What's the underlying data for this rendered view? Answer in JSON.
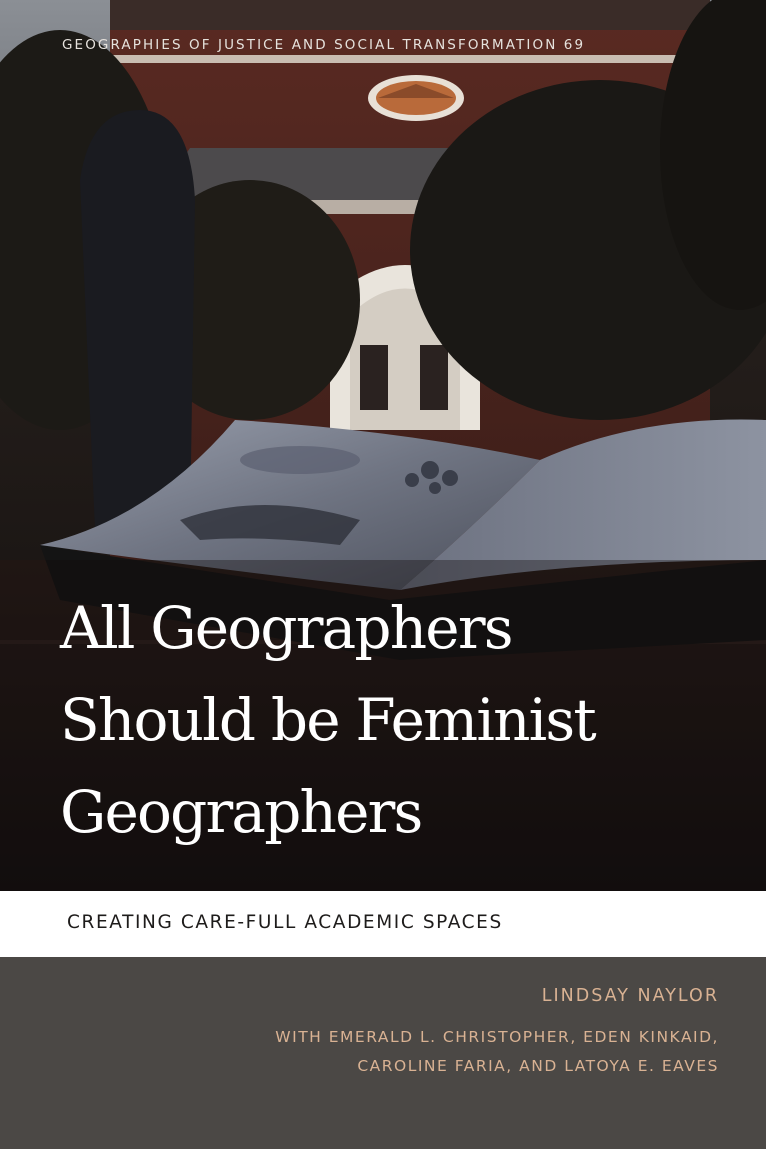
{
  "series": "GEOGRAPHIES OF JUSTICE AND SOCIAL TRANSFORMATION 69",
  "title_lines": [
    "All Geographers",
    "Should be Feminist",
    "Geographers"
  ],
  "subtitle": "CREATING CARE-FULL ACADEMIC SPACES",
  "author": "LINDSAY NAYLOR",
  "contributors": [
    "WITH EMERALD L. CHRISTOPHER, EDEN KINKAID,",
    "CAROLINE FARIA, AND LATOYA E. EAVES"
  ],
  "colors": {
    "title": "#ffffff",
    "author_text": "#d9b293",
    "band": "#ffffff",
    "author_background": "#4b4845"
  }
}
